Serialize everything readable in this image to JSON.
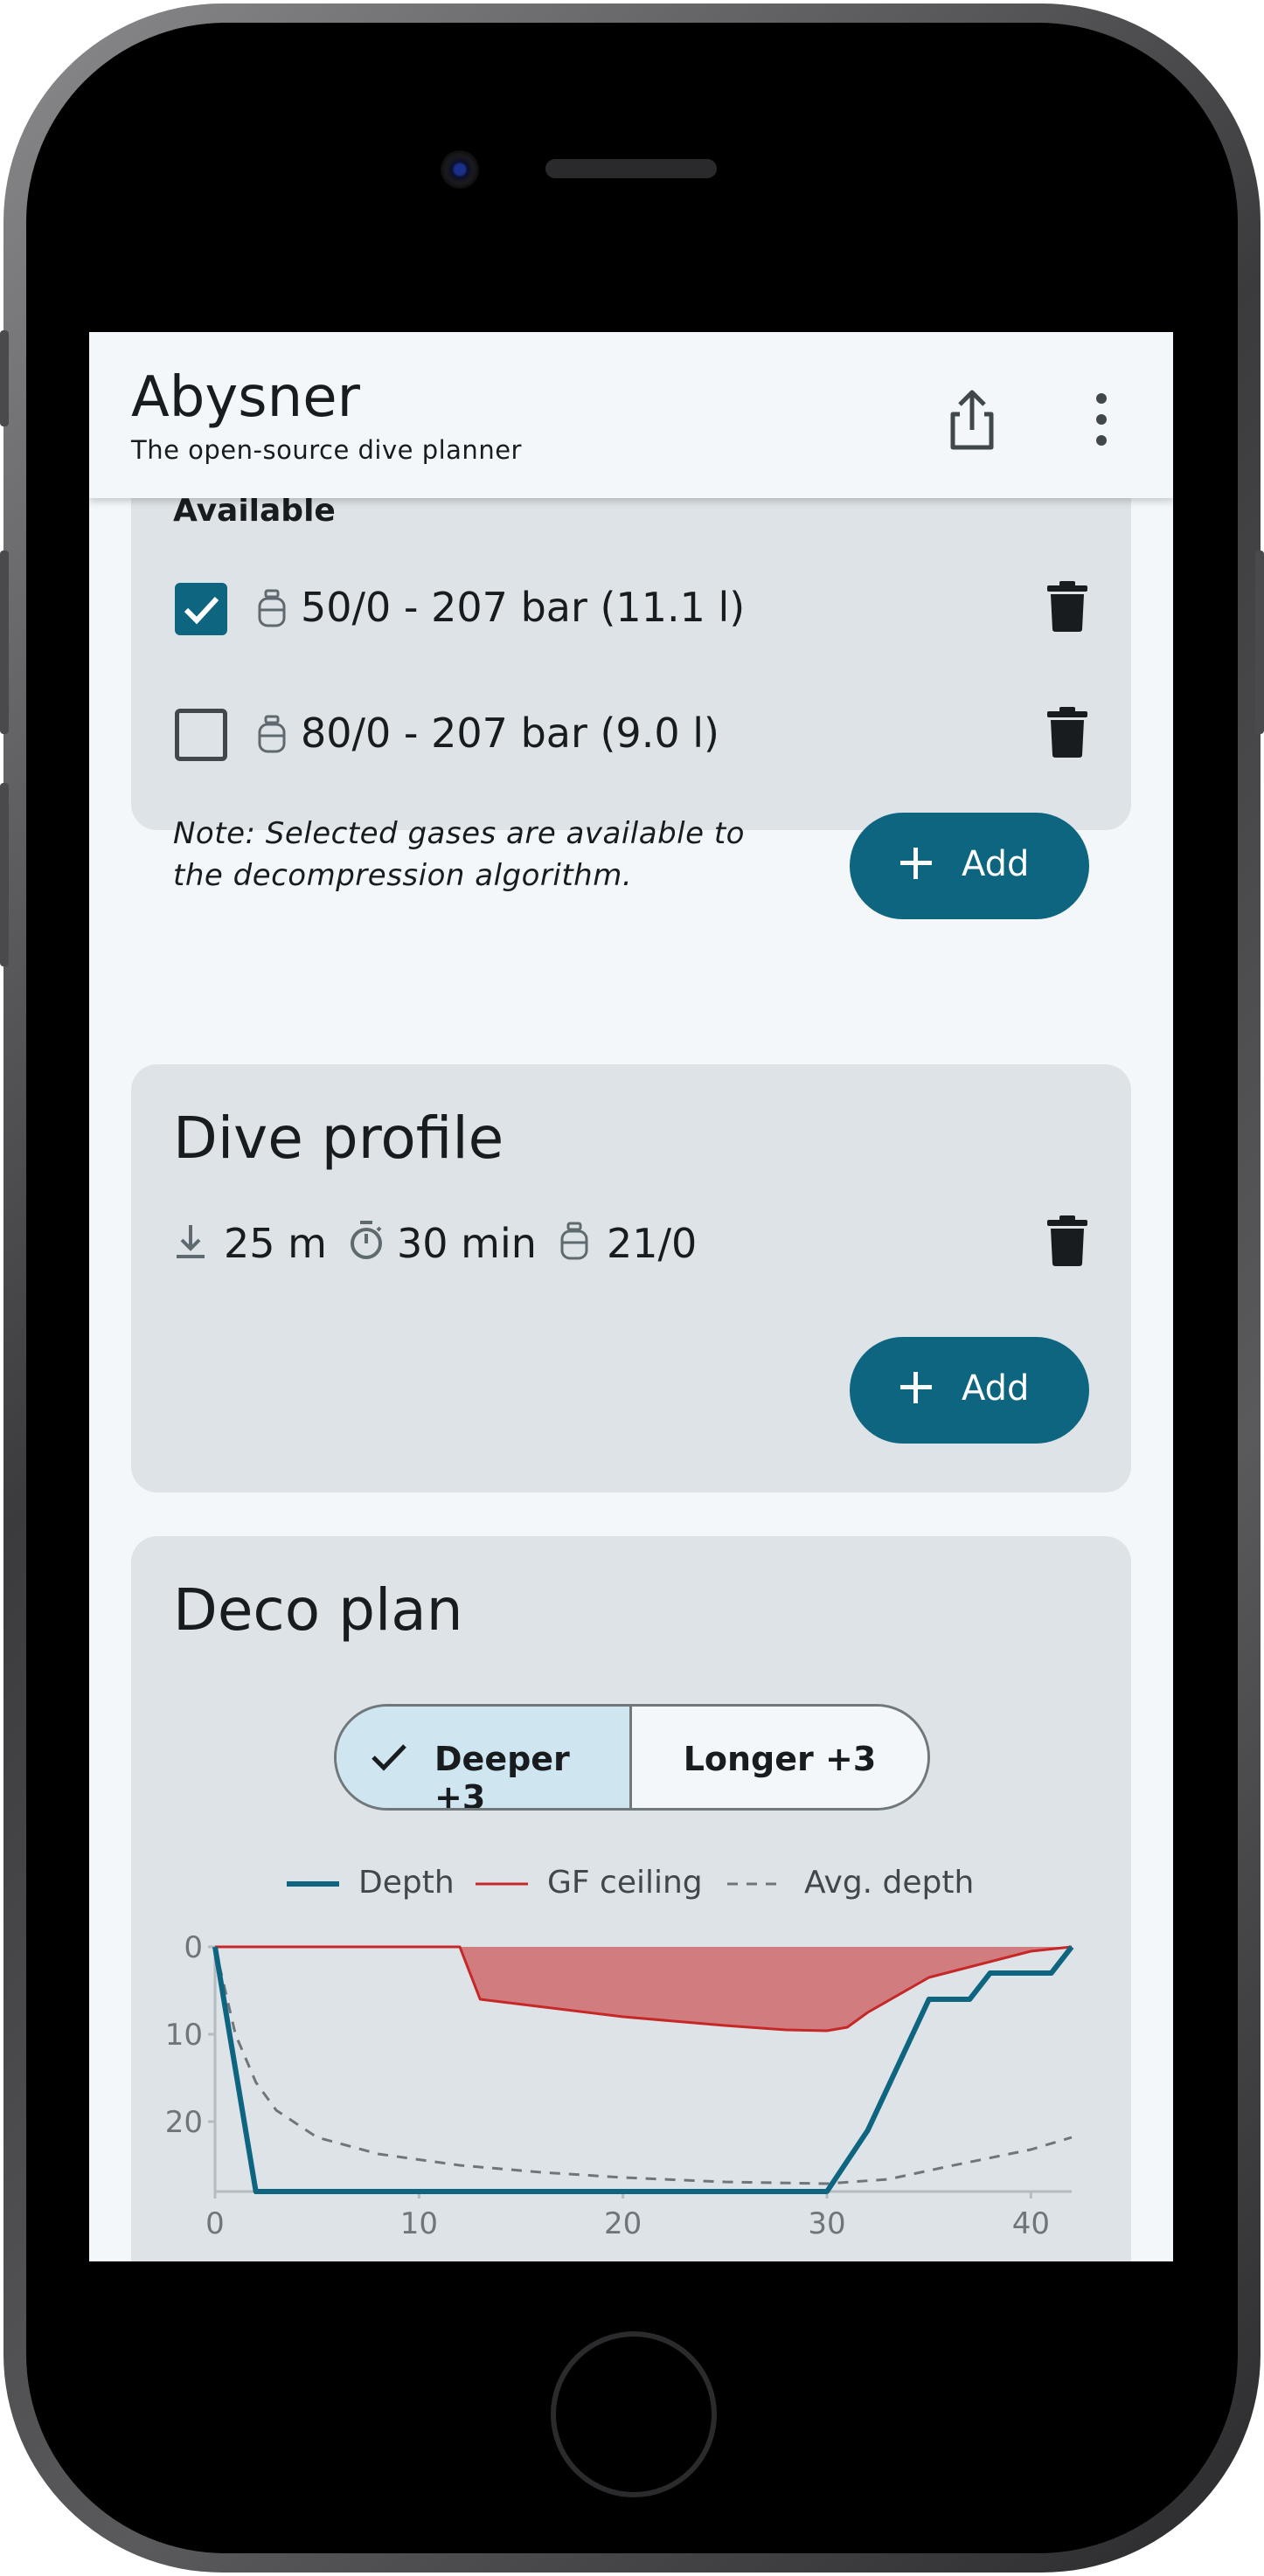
{
  "app": {
    "title": "Abysner",
    "subtitle": "The open-source dive planner"
  },
  "gases": {
    "section_label": "Available",
    "items": [
      {
        "label": "50/0 - 207 bar (11.1 l)",
        "checked": true
      },
      {
        "label": "80/0 - 207 bar (9.0 l)",
        "checked": false
      }
    ],
    "note": "Note: Selected gases are available to the decompression algorithm.",
    "add_label": "Add"
  },
  "dive_profile": {
    "title": "Dive profile",
    "depth": "25 m",
    "time": "30 min",
    "gas": "21/0",
    "add_label": "Add"
  },
  "deco_plan": {
    "title": "Deco plan",
    "toggle": {
      "deeper": "Deeper +3",
      "longer": "Longer +3",
      "selected": "deeper"
    },
    "legend": {
      "depth": "Depth",
      "gf_ceiling": "GF ceiling",
      "avg_depth": "Avg. depth"
    }
  },
  "colors": {
    "primary": "#0e6580",
    "card_bg": "#dde3e6",
    "screen_bg": "#f3f7fa",
    "ceiling_line": "#c62828",
    "ceiling_fill": "#d17c7f",
    "avg_line": "#6f7579"
  },
  "chart_data": {
    "type": "line",
    "title": "",
    "xlabel": "",
    "ylabel": "",
    "xlim": [
      0,
      42
    ],
    "ylim": [
      0,
      28
    ],
    "y_inverted": true,
    "x_ticks": [
      0,
      10,
      20,
      30,
      40
    ],
    "y_ticks": [
      0,
      10,
      20
    ],
    "series": [
      {
        "name": "Depth",
        "color": "#0e6580",
        "x": [
          0,
          2,
          30,
          32,
          35,
          37,
          38,
          41,
          42
        ],
        "y": [
          0,
          28,
          28,
          21,
          6,
          6,
          3,
          3,
          0
        ]
      },
      {
        "name": "GF ceiling",
        "color": "#c62828",
        "fill": true,
        "x": [
          0,
          12,
          13,
          20,
          25,
          28,
          30,
          31,
          32,
          35,
          40,
          42
        ],
        "y": [
          0,
          0,
          6,
          8,
          9,
          9.5,
          9.6,
          9.2,
          7.5,
          3.5,
          0.5,
          0
        ]
      },
      {
        "name": "Avg. depth",
        "color": "#6f7579",
        "dashed": true,
        "x": [
          0,
          1,
          2,
          3,
          5,
          8,
          12,
          16,
          20,
          25,
          30,
          33,
          36,
          40,
          42
        ],
        "y": [
          0,
          10,
          15.5,
          18.7,
          21.8,
          23.7,
          25,
          25.8,
          26.4,
          26.9,
          27.1,
          26.6,
          25.1,
          23.2,
          21.8
        ]
      }
    ]
  }
}
